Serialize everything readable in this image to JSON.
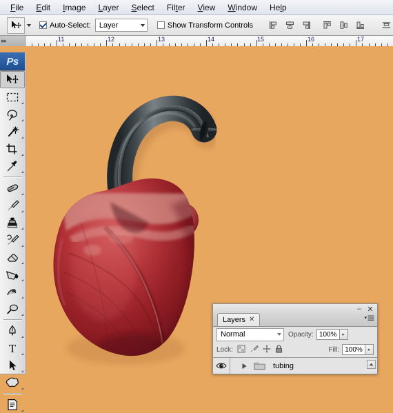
{
  "app": {
    "name": "Adobe Photoshop",
    "canvas_bg_color": "#e8a75f"
  },
  "menubar": {
    "items": [
      {
        "label": "File",
        "accel": "F"
      },
      {
        "label": "Edit",
        "accel": "E"
      },
      {
        "label": "Image",
        "accel": "I"
      },
      {
        "label": "Layer",
        "accel": "L"
      },
      {
        "label": "Select",
        "accel": "S"
      },
      {
        "label": "Filter",
        "accel": "t"
      },
      {
        "label": "View",
        "accel": "V"
      },
      {
        "label": "Window",
        "accel": "W"
      },
      {
        "label": "Help",
        "accel": "H"
      }
    ]
  },
  "options_bar": {
    "tool_preset_icon": "move-tool-icon",
    "auto_select_label": "Auto-Select:",
    "auto_select_checked": true,
    "auto_select_value": "Layer",
    "show_transform_label": "Show Transform Controls",
    "show_transform_checked": false,
    "align_buttons": [
      {
        "name": "align-left-edges-icon"
      },
      {
        "name": "align-horizontal-centers-icon"
      },
      {
        "name": "align-right-edges-icon"
      },
      {
        "name": "align-top-edges-icon"
      },
      {
        "name": "align-vertical-centers-icon"
      },
      {
        "name": "align-bottom-edges-icon"
      }
    ],
    "distribute_buttons": [
      {
        "name": "distribute-top-edges-icon"
      },
      {
        "name": "distribute-vertical-centers-icon"
      },
      {
        "name": "distribute-bottom-edges-icon"
      }
    ]
  },
  "ruler": {
    "unit": "inches",
    "labels": [
      "11",
      "12",
      "13",
      "14",
      "15",
      "16",
      "17"
    ],
    "label_positions": [
      82,
      154,
      227,
      299,
      371,
      444,
      516
    ],
    "minor_spacing": 9.05,
    "corner_arrows": "▸▸"
  },
  "toolbox": {
    "logo": "Ps",
    "tools": [
      {
        "name": "move-tool",
        "glyph": "move",
        "active": true,
        "has_flyout": false
      },
      {
        "name": "rectangular-marquee-tool",
        "glyph": "marquee",
        "active": false,
        "has_flyout": true
      },
      {
        "name": "lasso-tool",
        "glyph": "lasso",
        "active": false,
        "has_flyout": true
      },
      {
        "name": "magic-wand-tool",
        "glyph": "wand",
        "active": false,
        "has_flyout": true
      },
      {
        "name": "crop-tool",
        "glyph": "crop",
        "active": false,
        "has_flyout": true
      },
      {
        "name": "eyedropper-tool",
        "glyph": "eyedropper",
        "active": false,
        "has_flyout": true
      },
      {
        "name": "healing-brush-tool",
        "glyph": "healing",
        "active": false,
        "has_flyout": true
      },
      {
        "name": "brush-tool",
        "glyph": "brush",
        "active": false,
        "has_flyout": true
      },
      {
        "name": "clone-stamp-tool",
        "glyph": "stamp",
        "active": false,
        "has_flyout": true
      },
      {
        "name": "history-brush-tool",
        "glyph": "historybrush",
        "active": false,
        "has_flyout": true
      },
      {
        "name": "eraser-tool",
        "glyph": "eraser",
        "active": false,
        "has_flyout": true
      },
      {
        "name": "gradient-tool",
        "glyph": "paintbucket",
        "active": false,
        "has_flyout": true
      },
      {
        "name": "blur-tool",
        "glyph": "smudge",
        "active": false,
        "has_flyout": true
      },
      {
        "name": "dodge-tool",
        "glyph": "dodge",
        "active": false,
        "has_flyout": true
      },
      {
        "name": "pen-tool",
        "glyph": "pen",
        "active": false,
        "has_flyout": true
      },
      {
        "name": "horizontal-type-tool",
        "glyph": "type",
        "active": false,
        "has_flyout": true
      },
      {
        "name": "path-selection-tool",
        "glyph": "pathselect",
        "active": false,
        "has_flyout": true
      },
      {
        "name": "custom-shape-tool",
        "glyph": "shape",
        "active": false,
        "has_flyout": true
      },
      {
        "name": "notes-tool",
        "glyph": "notes",
        "active": false,
        "has_flyout": true
      }
    ]
  },
  "layers_panel": {
    "tab_label": "Layers",
    "tab_close_glyph": "✕",
    "minimize_glyph": "–",
    "close_glyph": "✕",
    "blend_mode": "Normal",
    "opacity_label": "Opacity:",
    "opacity_value": "100%",
    "lock_label": "Lock:",
    "lock_icons": [
      {
        "name": "lock-transparent-pixels-icon",
        "enabled": false
      },
      {
        "name": "lock-image-pixels-icon",
        "enabled": false
      },
      {
        "name": "lock-position-icon",
        "enabled": false
      },
      {
        "name": "lock-all-icon",
        "enabled": false
      }
    ],
    "fill_label": "Fill:",
    "fill_value": "100%",
    "layers": [
      {
        "name": "tubing",
        "type": "group",
        "visible": true,
        "expanded": false
      }
    ]
  },
  "artwork": {
    "description": "anatomical heart with corrugated hose",
    "background_color": "#e8a75f",
    "heart_colors": {
      "deep": "#8e1d24",
      "mid": "#b8323a",
      "light": "#d4757a",
      "pale": "#e0a8a4",
      "shadow": "#6d1219"
    },
    "hose_colors": {
      "dark": "#2f3438",
      "mid": "#565e62",
      "light": "#7b8488",
      "highlight": "#98a0a3"
    }
  }
}
